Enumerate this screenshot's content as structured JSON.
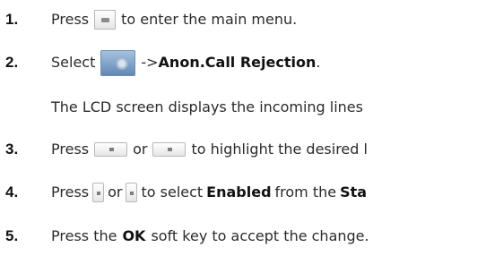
{
  "steps": [
    {
      "number": "1.",
      "before": "Press",
      "icon": "ok-key-icon",
      "after": "to enter the main menu."
    },
    {
      "number": "2.",
      "before": "Select",
      "icon": "features-icon",
      "arrow": "->",
      "target": "Anon.Call Rejection",
      "end": "."
    },
    {
      "continuation": "The LCD screen displays the incoming lines"
    },
    {
      "number": "3.",
      "before": "Press",
      "icon1": "up-arrow-key-icon",
      "middle": "or",
      "icon2": "down-arrow-key-icon",
      "after": "to highlight the desired l"
    },
    {
      "number": "4.",
      "before": "Press",
      "icon1": "left-arrow-key-icon",
      "middle": "or",
      "icon2": "right-arrow-key-icon",
      "after1": "to select",
      "bold1": "Enabled",
      "after2": "from the",
      "bold2": "Sta"
    },
    {
      "number": "5.",
      "before": "Press the",
      "bold": "OK",
      "after": "soft key to accept the change."
    }
  ]
}
